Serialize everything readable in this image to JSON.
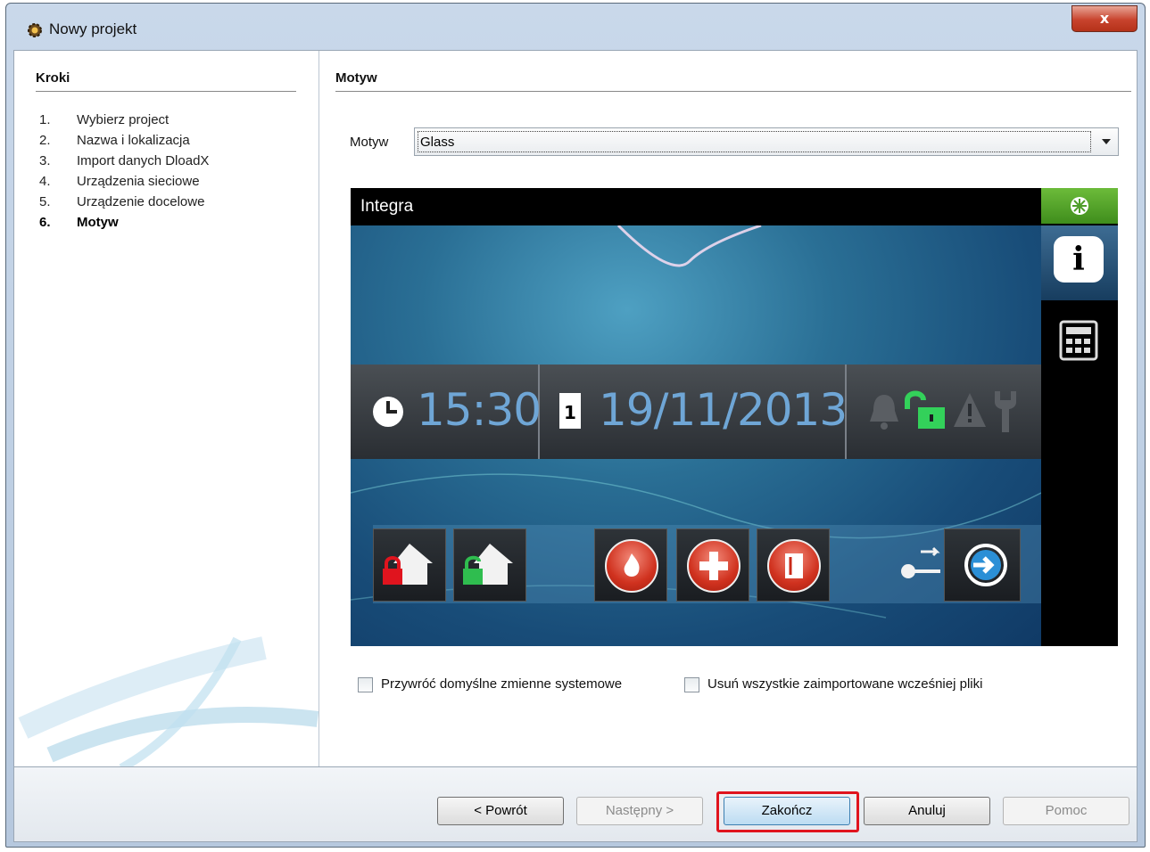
{
  "window": {
    "title": "Nowy projekt",
    "close_label": "x"
  },
  "steps": {
    "heading": "Kroki",
    "items": [
      {
        "num": "1.",
        "label": "Wybierz project"
      },
      {
        "num": "2.",
        "label": "Nazwa i lokalizacja"
      },
      {
        "num": "3.",
        "label": "Import danych DloadX"
      },
      {
        "num": "4.",
        "label": "Urządzenia sieciowe"
      },
      {
        "num": "5.",
        "label": "Urządzenie docelowe"
      },
      {
        "num": "6.",
        "label": "Motyw",
        "active": true
      }
    ]
  },
  "main": {
    "heading": "Motyw",
    "theme_label": "Motyw",
    "theme_value": "Glass"
  },
  "preview": {
    "header": "Integra",
    "time": "15:30",
    "date": "19/11/2013",
    "calendar_day": "1",
    "info_glyph": "i"
  },
  "options": {
    "restore_defaults": "Przywróć domyślne zmienne systemowe",
    "remove_imported": "Usuń wszystkie zaimportowane wcześniej pliki"
  },
  "buttons": {
    "back": "< Powrót",
    "next": "Następny >",
    "finish": "Zakończ",
    "cancel": "Anuluj",
    "help": "Pomoc"
  },
  "colors": {
    "highlight": "#e0141e",
    "preview_accent": "#6fa6d6",
    "side_top": "#4f9e2a"
  }
}
